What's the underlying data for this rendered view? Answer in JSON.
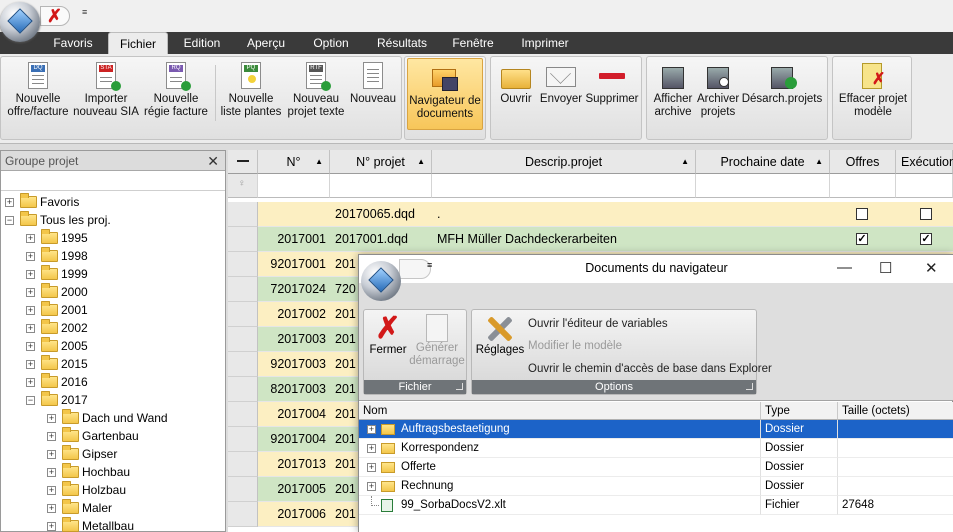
{
  "qat": {
    "dropdown_glyph": "≡"
  },
  "tabs": [
    "Favoris",
    "Fichier",
    "Edition",
    "Aperçu",
    "Option",
    "Résultats",
    "Fenêtre",
    "Imprimer"
  ],
  "ribbon": {
    "buttons": [
      {
        "line1": "Nouvelle",
        "line2": "offre/facture",
        "tag": "DQ",
        "icon": "new-offer-icon"
      },
      {
        "line1": "Importer",
        "line2": "nouveau SIA",
        "tag": "STA",
        "icon": "import-sia-icon"
      },
      {
        "line1": "Nouvelle",
        "line2": "régie facture",
        "tag": "RQ",
        "icon": "new-invoice-icon"
      },
      {
        "line1": "Nouvelle",
        "line2": "liste plantes",
        "tag": "PQ",
        "icon": "plant-list-icon"
      },
      {
        "line1": "Nouveau",
        "line2": "projet texte",
        "tag": "RTF",
        "icon": "text-project-icon"
      },
      {
        "line1": "Nouveau",
        "line2": "",
        "tag": "",
        "icon": "new-document-icon"
      },
      {
        "line1": "Navigateur de",
        "line2": "documents",
        "tag": "",
        "icon": "document-navigator-icon"
      },
      {
        "line1": "Ouvrir",
        "line2": "",
        "tag": "",
        "icon": "open-folder-icon"
      },
      {
        "line1": "Envoyer",
        "line2": "",
        "tag": "",
        "icon": "envelope-icon"
      },
      {
        "line1": "Supprimer",
        "line2": "",
        "tag": "",
        "icon": "delete-icon"
      },
      {
        "line1": "Afficher",
        "line2": "archive",
        "tag": "",
        "icon": "show-archive-icon"
      },
      {
        "line1": "Archiver",
        "line2": "projets",
        "tag": "",
        "icon": "archive-projects-icon"
      },
      {
        "line1": "Désarch.projets",
        "line2": "",
        "tag": "",
        "icon": "unarchive-icon"
      },
      {
        "line1": "Effacer projet",
        "line2": "modèle",
        "tag": "",
        "icon": "delete-template-icon"
      }
    ]
  },
  "left_panel": {
    "title": "Groupe projet",
    "close": "✕",
    "tree": [
      {
        "label": "Favoris",
        "level": 0,
        "pm": "+"
      },
      {
        "label": "Tous les proj.",
        "level": 0,
        "pm": "−"
      },
      {
        "label": "1995",
        "level": 1,
        "pm": "+"
      },
      {
        "label": "1998",
        "level": 1,
        "pm": "+"
      },
      {
        "label": "1999",
        "level": 1,
        "pm": "+"
      },
      {
        "label": "2000",
        "level": 1,
        "pm": "+"
      },
      {
        "label": "2001",
        "level": 1,
        "pm": "+"
      },
      {
        "label": "2002",
        "level": 1,
        "pm": "+"
      },
      {
        "label": "2005",
        "level": 1,
        "pm": "+"
      },
      {
        "label": "2015",
        "level": 1,
        "pm": "+"
      },
      {
        "label": "2016",
        "level": 1,
        "pm": "+"
      },
      {
        "label": "2017",
        "level": 1,
        "pm": "−"
      },
      {
        "label": "Dach und Wand",
        "level": 2,
        "pm": "+"
      },
      {
        "label": "Gartenbau",
        "level": 2,
        "pm": "+"
      },
      {
        "label": "Gipser",
        "level": 2,
        "pm": "+"
      },
      {
        "label": "Hochbau",
        "level": 2,
        "pm": "+"
      },
      {
        "label": "Holzbau",
        "level": 2,
        "pm": "+"
      },
      {
        "label": "Maler",
        "level": 2,
        "pm": "+"
      },
      {
        "label": "Metallbau",
        "level": 2,
        "pm": "+"
      }
    ]
  },
  "grid": {
    "headers": [
      "N°",
      "N° projet",
      "Descrip.projet",
      "Prochaine date",
      "Offres",
      "Exécution"
    ],
    "rows": [
      {
        "no": "",
        "proj": "20170065.dqd",
        "desc": ".",
        "color": "#fcefc2",
        "offres": false,
        "exec": false,
        "show_cb": true
      },
      {
        "no": "2017001",
        "proj": "2017001.dqd",
        "desc": "MFH Müller Dachdeckerarbeiten",
        "color": "#cfe5c4",
        "offres": true,
        "exec": true,
        "show_cb": true
      },
      {
        "no": "92017001",
        "proj": "201",
        "desc": "",
        "color": "#fcefc2",
        "show_cb": false
      },
      {
        "no": "72017024",
        "proj": "720",
        "desc": "",
        "color": "#cfe5c4",
        "show_cb": false
      },
      {
        "no": "2017002",
        "proj": "201",
        "desc": "",
        "color": "#fcefc2",
        "show_cb": false
      },
      {
        "no": "2017003",
        "proj": "201",
        "desc": "",
        "color": "#cfe5c4",
        "show_cb": false
      },
      {
        "no": "92017003",
        "proj": "201",
        "desc": "",
        "color": "#fcefc2",
        "show_cb": false
      },
      {
        "no": "82017003",
        "proj": "201",
        "desc": "",
        "color": "#cfe5c4",
        "show_cb": false
      },
      {
        "no": "2017004",
        "proj": "201",
        "desc": "",
        "color": "#fcefc2",
        "show_cb": false
      },
      {
        "no": "92017004",
        "proj": "201",
        "desc": "",
        "color": "#cfe5c4",
        "show_cb": false
      },
      {
        "no": "2017013",
        "proj": "201",
        "desc": "",
        "color": "#fcefc2",
        "show_cb": false
      },
      {
        "no": "2017005",
        "proj": "201",
        "desc": "",
        "color": "#cfe5c4",
        "show_cb": false
      },
      {
        "no": "2017006",
        "proj": "201",
        "desc": "",
        "color": "#fcefc2",
        "show_cb": false
      }
    ]
  },
  "dialog": {
    "title": "Documents du navigateur",
    "controls": {
      "min": "—",
      "max": "☐",
      "close": "✕"
    },
    "fichier_group": {
      "label": "Fichier",
      "close": "Fermer",
      "gen1": "Générer",
      "gen2": "démarrage"
    },
    "options_group": {
      "label": "Options",
      "reglages": "Réglages",
      "link1": "Ouvrir l'éditeur de variables",
      "link2": "Modifier le modèle",
      "link3": "Ouvrir le chemin d'accès de base dans Explorer"
    },
    "columns": [
      "Nom",
      "Type",
      "Taille (octets)"
    ],
    "files": [
      {
        "name": "Auftragsbestaetigung",
        "type": "Dossier",
        "size": "",
        "kind": "folder",
        "selected": true
      },
      {
        "name": "Korrespondenz",
        "type": "Dossier",
        "size": "",
        "kind": "folder",
        "selected": false
      },
      {
        "name": "Offerte",
        "type": "Dossier",
        "size": "",
        "kind": "folder",
        "selected": false
      },
      {
        "name": "Rechnung",
        "type": "Dossier",
        "size": "",
        "kind": "folder",
        "selected": false
      },
      {
        "name": "99_SorbaDocsV2.xlt",
        "type": "Fichier",
        "size": "27648",
        "kind": "file",
        "selected": false
      }
    ]
  }
}
